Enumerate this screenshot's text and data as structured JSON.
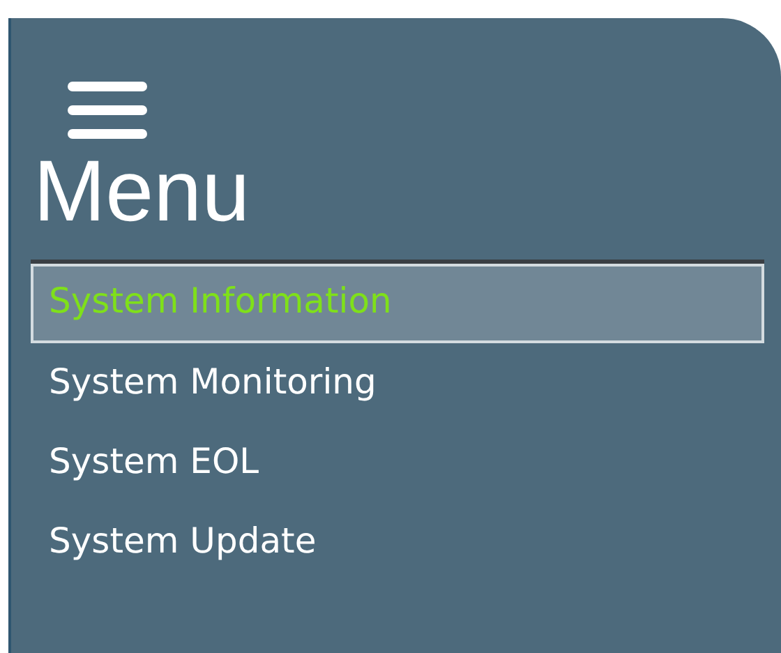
{
  "menu": {
    "title": "Menu",
    "items": [
      {
        "label": "System Information",
        "selected": true
      },
      {
        "label": "System Monitoring",
        "selected": false
      },
      {
        "label": "System EOL",
        "selected": false
      },
      {
        "label": "System Update",
        "selected": false
      }
    ]
  }
}
